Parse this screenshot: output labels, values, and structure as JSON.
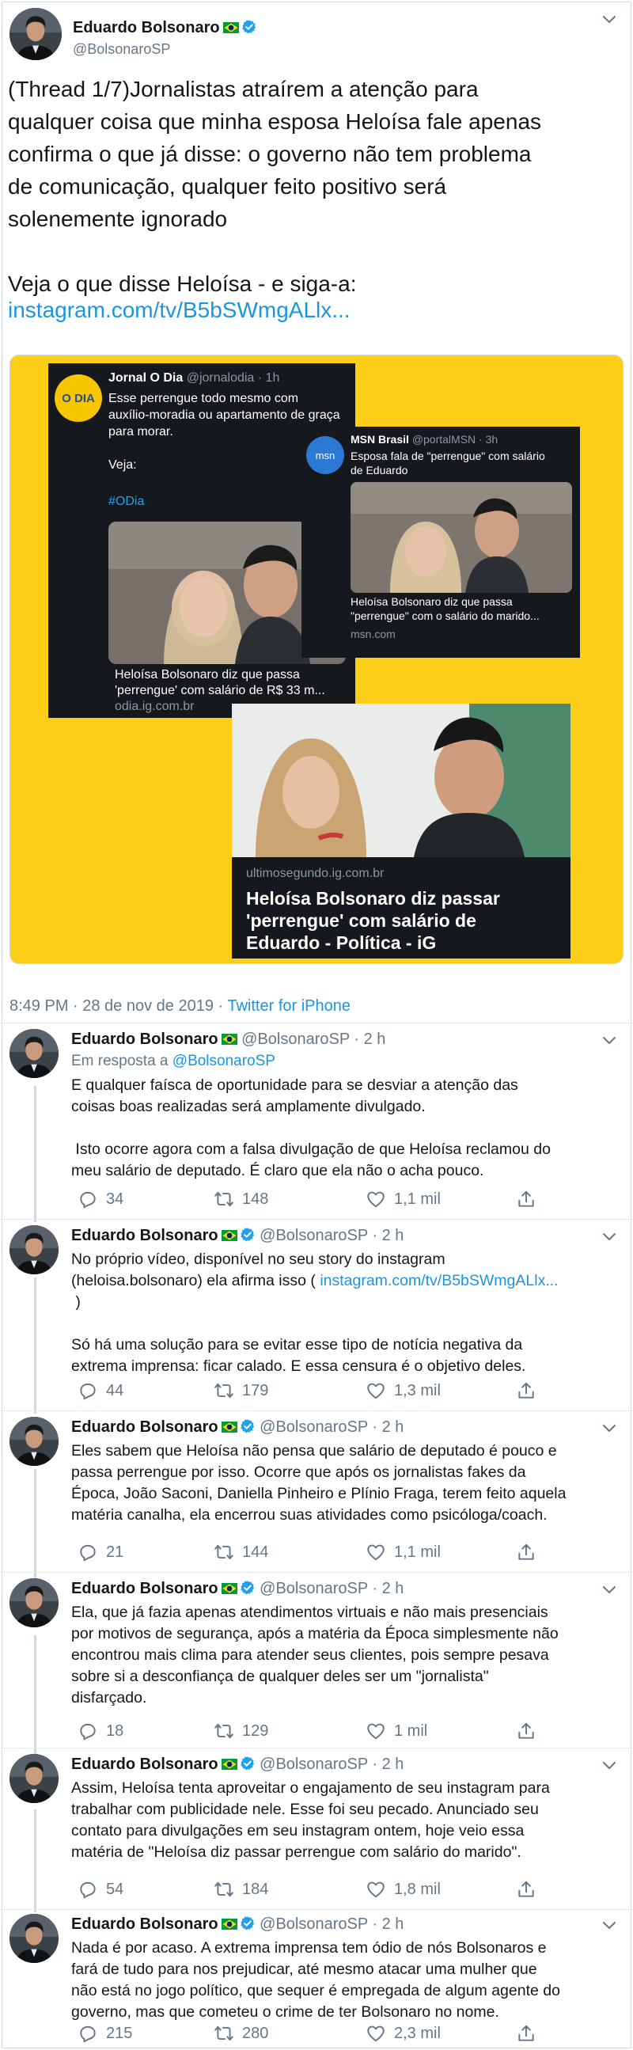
{
  "main": {
    "name": "Eduardo Bolsonaro",
    "handle": "@BolsonaroSP",
    "text": "(Thread 1/7)Jornalistas atraírem a atenção para\nqualquer coisa que minha esposa Heloísa fale apenas\nconfirma o que já disse: o governo não tem problema\nde comunicação, qualquer feito positivo será\nsolenemente ignorado\n\nVeja o que disse Heloísa - e siga-a:",
    "link": "instagram.com/tv/B5bSWmgALlx...",
    "timestamp": "8:49 PM · 28 de nov de 2019 · ",
    "source": "Twitter for iPhone"
  },
  "media": {
    "odia": {
      "logo": "O DIA",
      "name": "Jornal O Dia",
      "handle": "@jornalodia · 1h",
      "text": "Esse perrengue todo mesmo com\nauxílio-moradia ou apartamento de graça\npara morar.",
      "veja": "Veja:",
      "hashtag": "#ODia",
      "caption": "Heloísa Bolsonaro diz que passa\n'perrengue' com salário de R$ 33 m...",
      "domain": "odia.ig.com.br"
    },
    "msn": {
      "logo": "msn",
      "name": "MSN Brasil",
      "handle": "@portalMSN · 3h",
      "text": "Esposa fala de \"perrengue\" com salário\nde Eduardo",
      "caption": "Heloísa Bolsonaro diz que passa\n\"perrengue\" com o salário do marido...",
      "domain": "msn.com"
    },
    "ig": {
      "domain": "ultimosegundo.ig.com.br",
      "headline": "Heloísa Bolsonaro diz passar\n'perrengue' com salário de\nEduardo - Política - iG"
    }
  },
  "replies": [
    {
      "name": "Eduardo Bolsonaro",
      "handle": "@BolsonaroSP · 2 h",
      "reply_label": "Em resposta a ",
      "reply_to": "@BolsonaroSP",
      "body": "E qualquer faísca de oportunidade para se desviar a atenção das\ncoisas boas realizadas será amplamente divulgado.\n\n Isto ocorre agora com a falsa divulgação de que Heloísa reclamou do\nmeu salário de deputado. É claro que ela não o acha pouco.",
      "replies": "34",
      "retweets": "148",
      "likes": "1,1 mil"
    },
    {
      "name": "Eduardo Bolsonaro",
      "handle": "@BolsonaroSP · 2 h",
      "body_a": "No próprio vídeo, disponível no seu story do instagram\n(heloisa.bolsonaro) ela afirma isso ( ",
      "body_link": "instagram.com/tv/B5bSWmgALlx...",
      "body_b": "\n )\n\nSó há uma solução para se evitar esse tipo de notícia negativa da\nextrema imprensa: ficar calado. E essa censura é o objetivo deles.",
      "replies": "44",
      "retweets": "179",
      "likes": "1,3 mil"
    },
    {
      "name": "Eduardo Bolsonaro",
      "handle": "@BolsonaroSP · 2 h",
      "body": "Eles sabem que Heloísa não pensa que salário de deputado é pouco e\npassa perrengue por isso. Ocorre que após os jornalistas fakes da\nÉpoca, João Saconi, Daniella Pinheiro e Plínio Fraga, terem feito aquela\nmatéria canalha, ela encerrou suas atividades como psicóloga/coach.",
      "replies": "21",
      "retweets": "144",
      "likes": "1,1 mil"
    },
    {
      "name": "Eduardo Bolsonaro",
      "handle": "@BolsonaroSP · 2 h",
      "body": "Ela, que já fazia apenas atendimentos virtuais e não mais presenciais\npor motivos de segurança, após a matéria da Época simplesmente não\nencontrou mais clima para atender seus clientes, pois sempre pesava\nsobre si a desconfiança de qualquer deles ser um \"jornalista\"\ndisfarçado.",
      "replies": "18",
      "retweets": "129",
      "likes": "1 mil"
    },
    {
      "name": "Eduardo Bolsonaro",
      "handle": "@BolsonaroSP · 2 h",
      "body": "Assim, Heloísa tenta aproveitar o engajamento de seu instagram para\ntrabalhar com publicidade nele. Esse foi seu pecado. Anunciado seu\ncontato para divulgações em seu instagram ontem, hoje veio essa\nmatéria de \"Heloísa diz passar perrengue com salário do marido\".",
      "replies": "54",
      "retweets": "184",
      "likes": "1,8 mil"
    },
    {
      "name": "Eduardo Bolsonaro",
      "handle": "@BolsonaroSP · 2 h",
      "body": "Nada é por acaso. A extrema imprensa tem ódio de nós Bolsonaros e\nfará de tudo para nos prejudicar, até mesmo atacar uma mulher que\nnão está no jogo político, que sequer é empregada de algum agente do\ngoverno, mas que cometeu o crime de ter Bolsonaro no nome.",
      "replies": "215",
      "retweets": "280",
      "likes": "2,3 mil"
    }
  ],
  "colors": {
    "link": "#1b95e0",
    "muted": "#657786",
    "media_background": "#fcce18",
    "card_background": "#15181c"
  },
  "icons": [
    "reply-icon",
    "retweet-icon",
    "like-icon",
    "share-icon",
    "verified-icon",
    "brazil-flag-icon",
    "chevron-down-icon"
  ]
}
